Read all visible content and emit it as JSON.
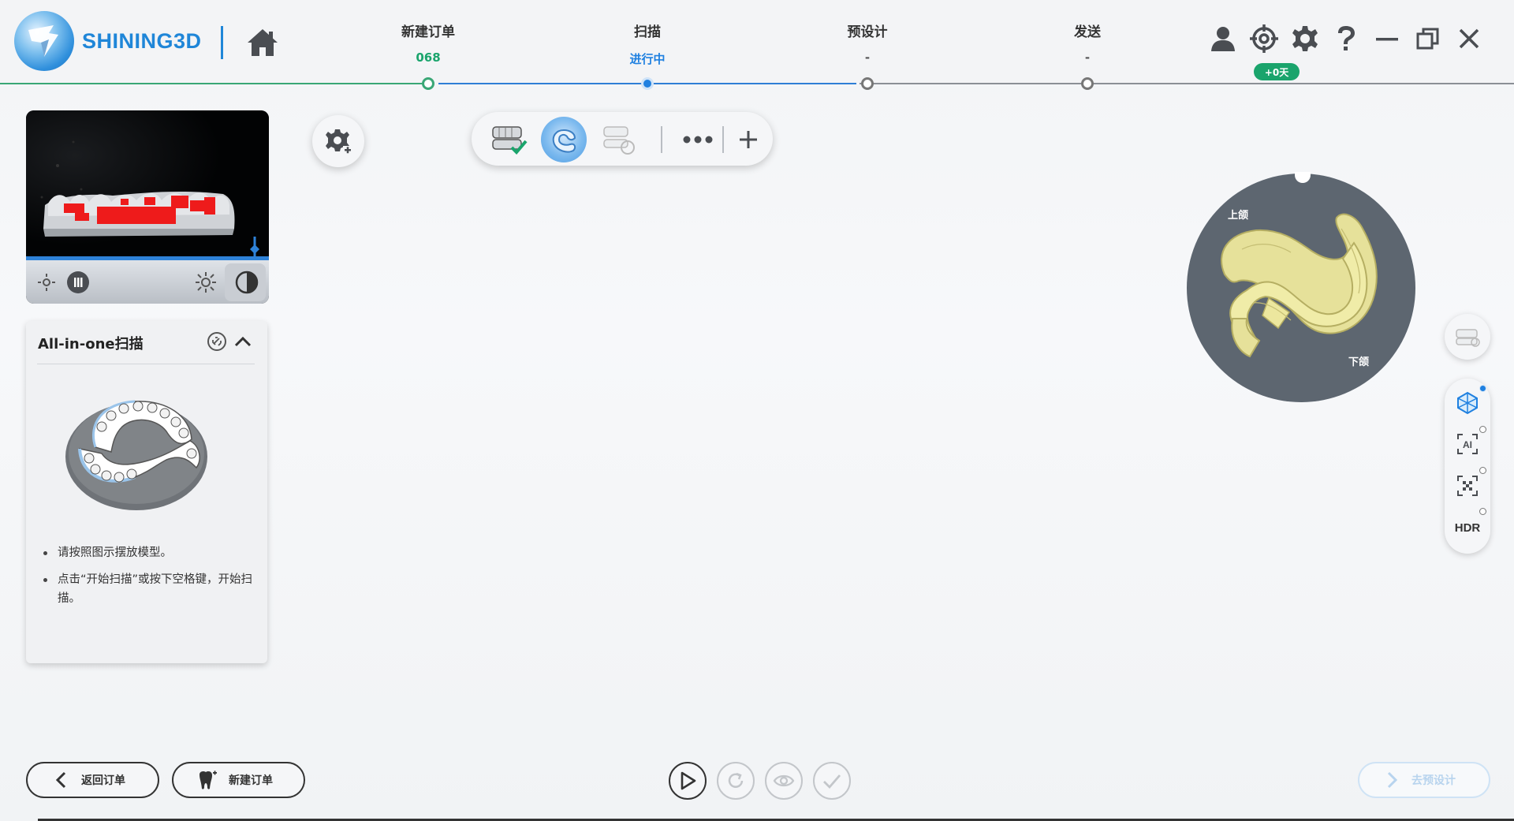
{
  "app": {
    "brand": "SHINING3D"
  },
  "steps": [
    {
      "label": "新建订单",
      "sub": "068",
      "color": "#1aa46c"
    },
    {
      "label": "扫描",
      "sub": "进行中",
      "color": "#1f80e0"
    },
    {
      "label": "预设计",
      "sub": "-",
      "color": "#555555"
    },
    {
      "label": "发送",
      "sub": "-",
      "color": "#555555"
    }
  ],
  "header": {
    "license_badge": "+0天",
    "icons": [
      "user-icon",
      "target-icon",
      "gear-icon",
      "help-icon",
      "minimize-icon",
      "restore-icon",
      "close-icon"
    ]
  },
  "scan_panel": {
    "title": "All-in-one扫描",
    "instructions": [
      "请按照图示摆放模型。",
      "点击“开始扫描”或按下空格键，开始扫描。"
    ]
  },
  "jaw_map": {
    "upper_label": "上颌",
    "lower_label": "下颌"
  },
  "side_tools": {
    "hdr_label": "HDR",
    "ai_label": "AI"
  },
  "footer": {
    "back_label": "返回订单",
    "new_order_label": "新建订单",
    "next_label": "去预设计"
  },
  "colors": {
    "accent": "#1f80e0",
    "brand": "#1f86d8",
    "success": "#1aa46c"
  }
}
